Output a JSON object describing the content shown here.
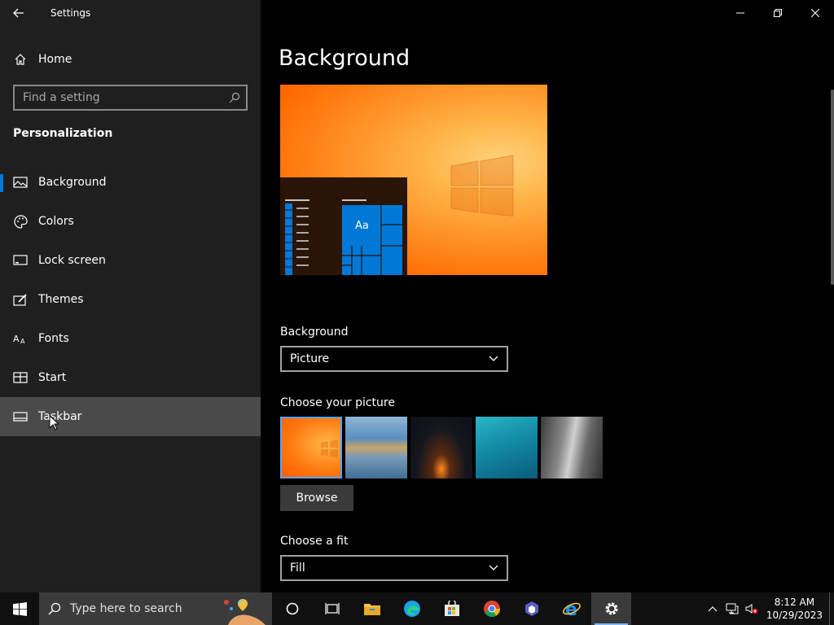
{
  "window": {
    "title": "Settings"
  },
  "sidebar": {
    "home_label": "Home",
    "search_placeholder": "Find a setting",
    "section_title": "Personalization",
    "items": [
      {
        "label": "Background",
        "icon": "picture-icon",
        "selected": true
      },
      {
        "label": "Colors",
        "icon": "palette-icon"
      },
      {
        "label": "Lock screen",
        "icon": "lock-screen-icon"
      },
      {
        "label": "Themes",
        "icon": "themes-icon"
      },
      {
        "label": "Fonts",
        "icon": "fonts-icon"
      },
      {
        "label": "Start",
        "icon": "start-icon"
      },
      {
        "label": "Taskbar",
        "icon": "taskbar-icon",
        "hovered": true
      }
    ]
  },
  "main": {
    "title": "Background",
    "preview_tile_text": "Aa",
    "background_label": "Background",
    "background_value": "Picture",
    "choose_picture_label": "Choose your picture",
    "browse_label": "Browse",
    "choose_fit_label": "Choose a fit",
    "fit_value": "Fill"
  },
  "taskbar": {
    "search_placeholder": "Type here to search",
    "time": "8:12 AM",
    "date": "10/29/2023",
    "apps": [
      "cortana-icon",
      "task-view-icon",
      "file-explorer-icon",
      "edge-icon",
      "store-icon",
      "chrome-icon",
      "app-icon",
      "internet-explorer-icon",
      "settings-icon"
    ]
  },
  "colors": {
    "accent": "#0078d7",
    "sidebar_bg": "#1f1f1f",
    "hover_bg": "#4a4a4a"
  }
}
